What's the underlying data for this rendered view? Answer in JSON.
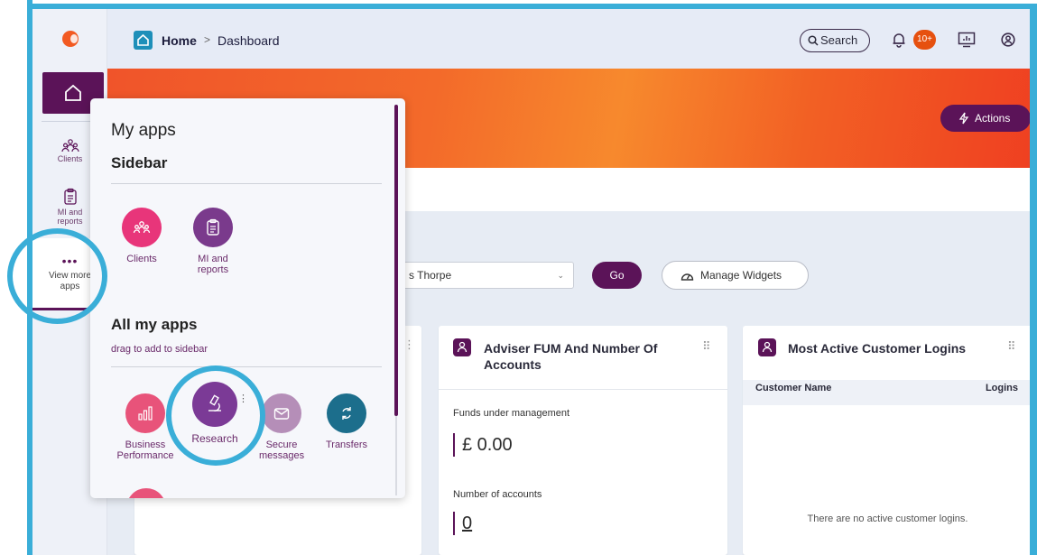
{
  "header": {
    "breadcrumb_home": "Home",
    "breadcrumb_separator": ">",
    "breadcrumb_current": "Dashboard",
    "search_label": "Search",
    "notification_badge": "10+"
  },
  "sidebar": {
    "items": [
      {
        "label": "Clients",
        "icon": "clients-icon"
      },
      {
        "label": "MI and reports",
        "icon": "clipboard-icon"
      }
    ],
    "view_more_label": "View more apps"
  },
  "hero": {
    "actions_label": "Actions"
  },
  "controls": {
    "selected_adviser": "s Thorpe",
    "go_label": "Go",
    "manage_widgets_label": "Manage Widgets"
  },
  "cards": {
    "fum": {
      "title": "Adviser FUM And Number Of Accounts",
      "funds_label": "Funds under management",
      "funds_value": "£ 0.00",
      "accounts_label": "Number of accounts",
      "accounts_value": "0"
    },
    "logins": {
      "title": "Most Active Customer Logins",
      "col_name": "Customer Name",
      "col_logins": "Logins",
      "empty_message": "There are no active customer logins."
    }
  },
  "popover": {
    "title": "My apps",
    "sidebar_heading": "Sidebar",
    "sidebar_apps": [
      {
        "label": "Clients",
        "color": "#e8357a"
      },
      {
        "label": "MI and reports",
        "color": "#7a3a8c"
      }
    ],
    "all_apps_heading": "All my apps",
    "drag_hint": "drag to add to sidebar",
    "all_apps": [
      {
        "label": "Business Performance",
        "color": "#e8537a"
      },
      {
        "label": "Research",
        "color": "#7b3a96"
      },
      {
        "label": "Secure messages",
        "color": "#b58eb8"
      },
      {
        "label": "Transfers",
        "color": "#1c6e8c"
      }
    ]
  },
  "colors": {
    "brand_purple": "#5b1358",
    "accent_orange": "#f25a22",
    "highlight_ring": "#3aaed8"
  }
}
